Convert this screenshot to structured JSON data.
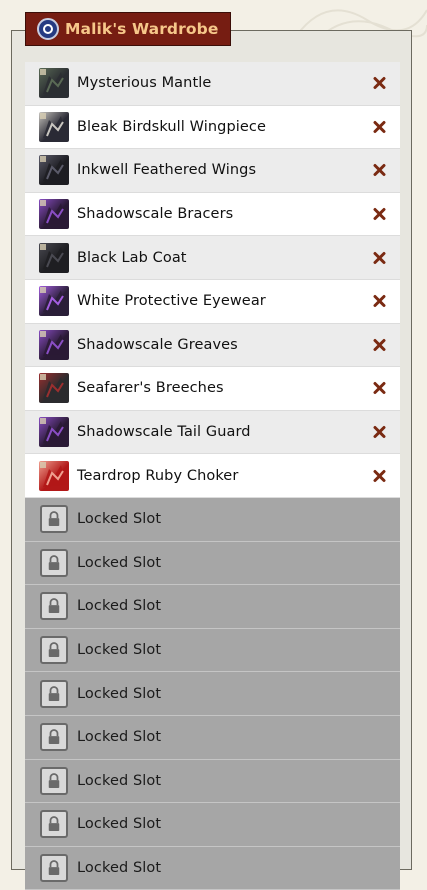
{
  "header": {
    "title": "Malik's Wardrobe",
    "icon": "eye-orb-icon"
  },
  "items": [
    {
      "name": "Mysterious Mantle",
      "icon": "mantle-icon",
      "colors": [
        "#2b2e33",
        "#5a6a55"
      ]
    },
    {
      "name": "Bleak Birdskull Wingpiece",
      "icon": "birdskull-wing-icon",
      "colors": [
        "#2a2a35",
        "#c9c6c0"
      ]
    },
    {
      "name": "Inkwell Feathered Wings",
      "icon": "feathered-wings-icon",
      "colors": [
        "#1d1d22",
        "#5b5b6a"
      ]
    },
    {
      "name": "Shadowscale Bracers",
      "icon": "bracers-icon",
      "colors": [
        "#2a1a35",
        "#8a4ec5"
      ]
    },
    {
      "name": "Black Lab Coat",
      "icon": "lab-coat-icon",
      "colors": [
        "#1e1e22",
        "#4a4a52"
      ]
    },
    {
      "name": "White Protective Eyewear",
      "icon": "eyewear-icon",
      "colors": [
        "#2a1f38",
        "#a45ee0"
      ]
    },
    {
      "name": "Shadowscale Greaves",
      "icon": "greaves-icon",
      "colors": [
        "#2a1a35",
        "#8a4ec5"
      ]
    },
    {
      "name": "Seafarer's Breeches",
      "icon": "breeches-icon",
      "colors": [
        "#2b2b2e",
        "#9b2f2f"
      ]
    },
    {
      "name": "Shadowscale Tail Guard",
      "icon": "tail-guard-icon",
      "colors": [
        "#2a1a35",
        "#8a4ec5"
      ]
    },
    {
      "name": "Teardrop Ruby Choker",
      "icon": "ruby-choker-icon",
      "colors": [
        "#b21818",
        "#f0a090"
      ]
    }
  ],
  "locked": [
    {
      "label": "Locked Slot"
    },
    {
      "label": "Locked Slot"
    },
    {
      "label": "Locked Slot"
    },
    {
      "label": "Locked Slot"
    },
    {
      "label": "Locked Slot"
    },
    {
      "label": "Locked Slot"
    },
    {
      "label": "Locked Slot"
    },
    {
      "label": "Locked Slot"
    },
    {
      "label": "Locked Slot"
    }
  ],
  "colors": {
    "header_bg": "#761d12",
    "header_text": "#f6c78a",
    "remove": "#7a2a12",
    "locked_bg": "#a6a6a6"
  }
}
